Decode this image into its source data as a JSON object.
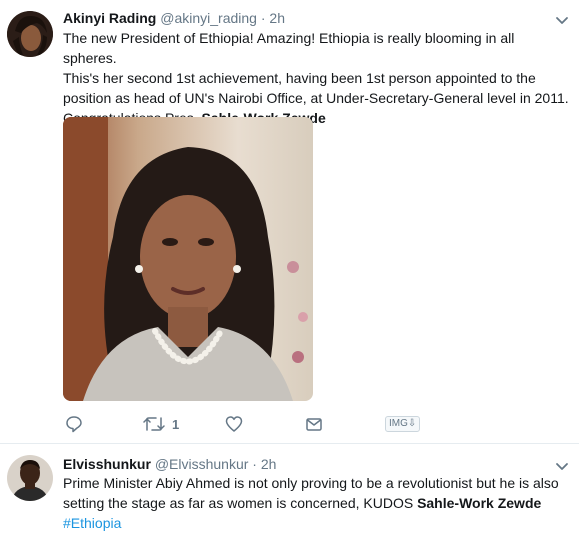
{
  "tweets": [
    {
      "name": "Akinyi Rading",
      "handle": "@akinyi_rading",
      "separator": "·",
      "time": "2h",
      "text_lines": [
        "The new President of Ethiopia! Amazing! Ethiopia is really blooming in all spheres.",
        "This's her second 1st achievement, having been 1st person appointed to the",
        "position as head of UN's Nairobi Office, at Under-Secretary-General level in 2011."
      ],
      "text_last_plain": "Congratulations Pres. ",
      "text_last_bold": "Sahle-Work Zewde",
      "actions": {
        "reply_icon": "reply-icon",
        "retweet_icon": "retweet-icon",
        "retweet_count": "1",
        "like_icon": "heart-icon",
        "dm_icon": "envelope-icon",
        "img_badge": "IMG⇩"
      },
      "caret_icon": "chevron-down-icon"
    },
    {
      "name": "Elvisshunkur",
      "handle": "@Elvisshunkur",
      "separator": "·",
      "time": "2h",
      "text_line1": "Prime Minister Abiy Ahmed is not only proving to be a revolutionist but he is also",
      "text_line2_plain": "setting the stage as far as women is concerned, KUDOS ",
      "text_line2_bold": "Sahle-Work Zewde",
      "hashtag": "#Ethiopia",
      "caret_icon": "chevron-down-icon"
    }
  ],
  "colors": {
    "link": "#1b95e0",
    "secondary": "#657786",
    "border": "#e6ecf0"
  }
}
